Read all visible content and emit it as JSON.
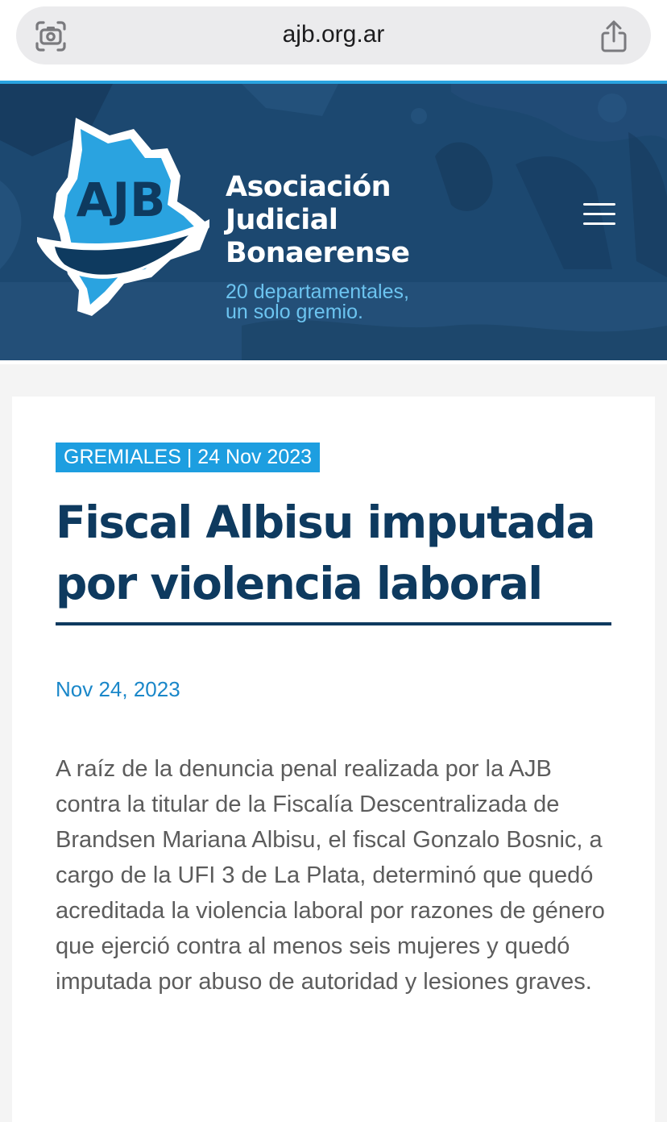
{
  "browser": {
    "url": "ajb.org.ar"
  },
  "header": {
    "logo_text": "AJB",
    "brand_line1": "Asociación",
    "brand_line2": "Judicial",
    "brand_line3": "Bonaerense",
    "tagline_line1": "20 departamentales,",
    "tagline_line2": "un solo gremio."
  },
  "article": {
    "category_tag": "GREMIALES | 24 Nov 2023",
    "title": "Fiscal Albisu imputada por violencia laboral",
    "date": "Nov 24, 2023",
    "body": "A raíz de la denuncia penal realizada por la AJB contra la titular de la Fiscalía Descentralizada de Brandsen Mariana Albisu, el fiscal Gonzalo Bosnic, a cargo de la UFI 3 de La Plata, determinó que quedó acreditada la violencia laboral por razones de género que ejerció contra al menos seis mujeres y quedó imputada por abuso de autoridad y lesiones graves."
  },
  "icons": {
    "lens": "visual-search-icon",
    "share": "share-icon",
    "menu": "hamburger-menu-icon"
  },
  "colors": {
    "header_bg": "#1c4870",
    "accent_blue": "#1d9ee0",
    "title_navy": "#0e3a5f",
    "date_blue": "#1a87c9",
    "body_gray": "#5c5c5c"
  }
}
